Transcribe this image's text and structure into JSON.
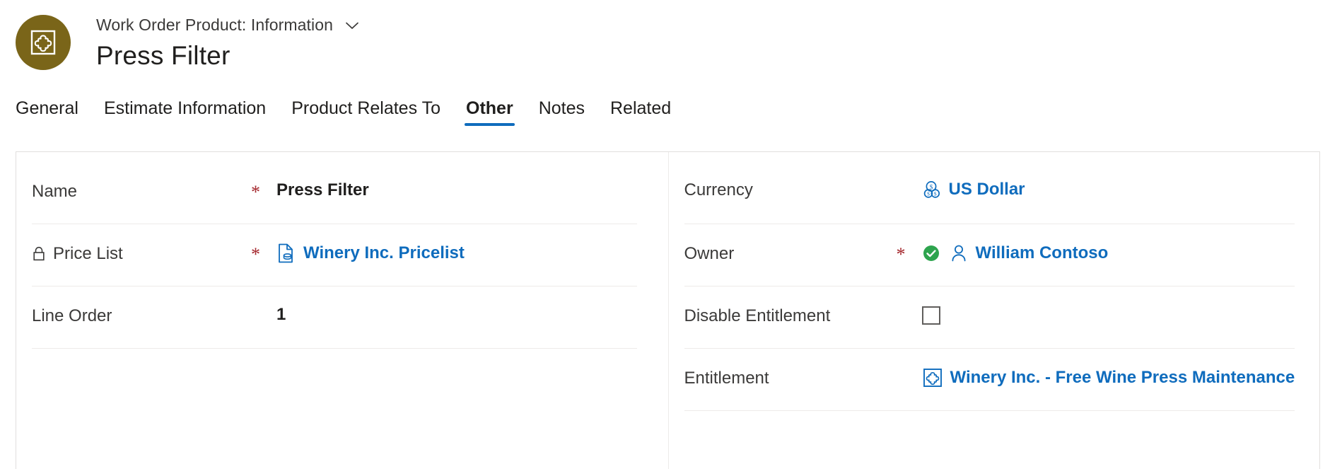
{
  "header": {
    "entity_icon": "product-puzzle-icon",
    "avatar_color": "#7a6519",
    "subtitle": "Work Order Product: Information",
    "chevron_icon": "chevron-down-icon",
    "title": "Press Filter"
  },
  "tabs": [
    {
      "label": "General",
      "active": false
    },
    {
      "label": "Estimate Information",
      "active": false
    },
    {
      "label": "Product Relates To",
      "active": false
    },
    {
      "label": "Other",
      "active": true
    },
    {
      "label": "Notes",
      "active": false
    },
    {
      "label": "Related",
      "active": false
    }
  ],
  "accent_color": "#0f6cbd",
  "required_marker": "*",
  "left_column": [
    {
      "label": "Name",
      "required": true,
      "lock": false,
      "value": "Press Filter",
      "value_type": "text",
      "icon": ""
    },
    {
      "label": "Price List",
      "required": true,
      "lock": true,
      "lock_icon": "lock-icon",
      "value": "Winery Inc. Pricelist",
      "value_type": "link",
      "icon": "pricelist-icon"
    },
    {
      "label": "Line Order",
      "required": false,
      "lock": false,
      "value": "1",
      "value_type": "text",
      "icon": ""
    }
  ],
  "right_column": [
    {
      "label": "Currency",
      "required": false,
      "lock": false,
      "value": "US Dollar",
      "value_type": "link",
      "icon": "currency-coins-icon"
    },
    {
      "label": "Owner",
      "required": true,
      "lock": false,
      "value": "William Contoso",
      "value_type": "link",
      "icon": "person-icon",
      "badge": "green-check-badge"
    },
    {
      "label": "Disable Entitlement",
      "required": false,
      "lock": false,
      "value": "",
      "value_type": "checkbox",
      "checked": false,
      "icon": ""
    },
    {
      "label": "Entitlement",
      "required": false,
      "lock": false,
      "value": "Winery Inc. - Free Wine Press Maintenance",
      "value_type": "link",
      "icon": "entitlement-puzzle-icon"
    }
  ]
}
